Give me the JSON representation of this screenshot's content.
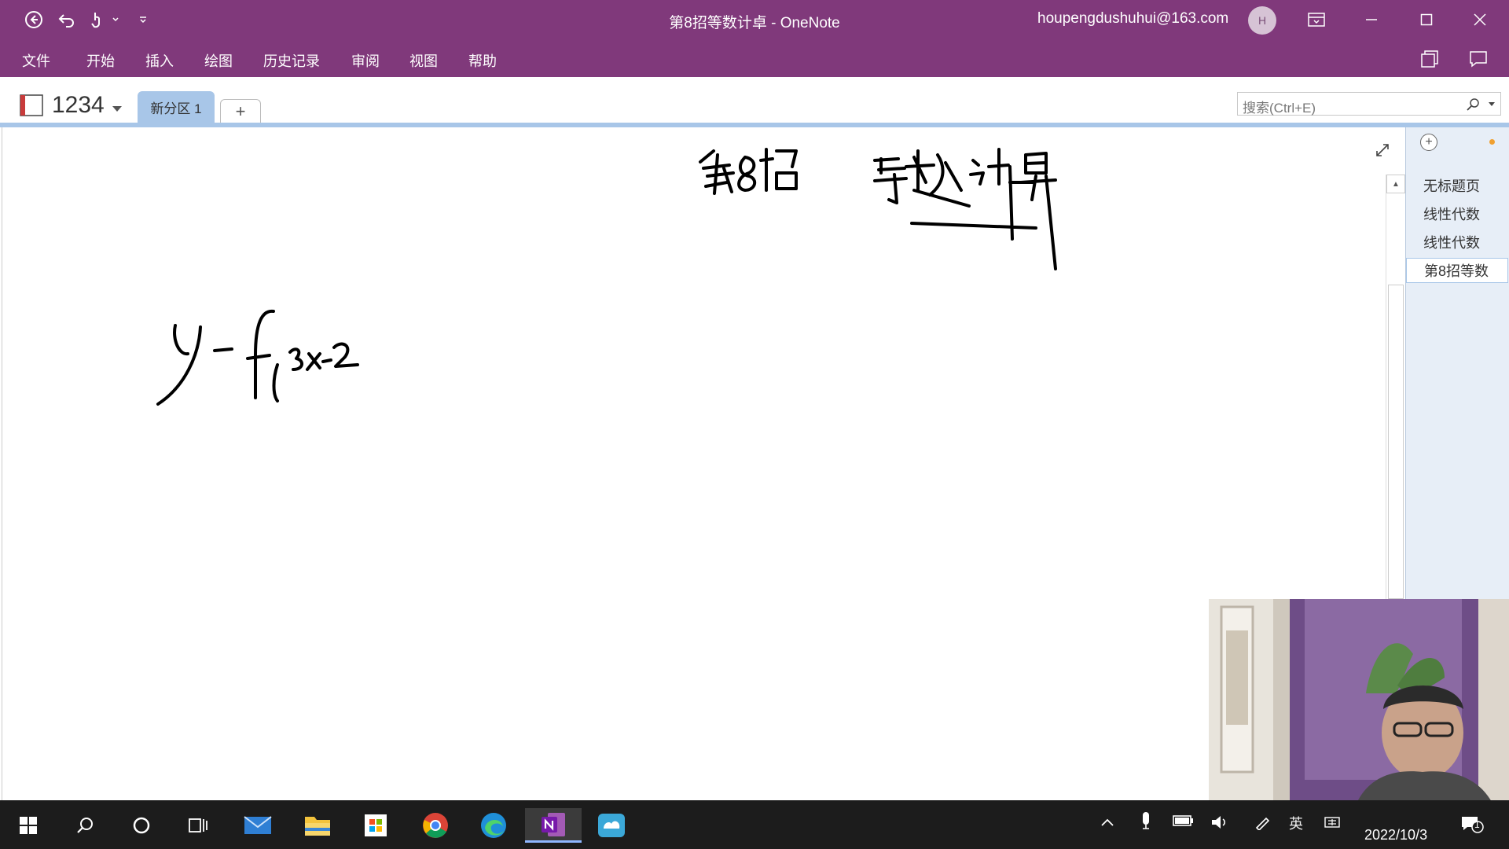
{
  "window": {
    "title": "第8招等数计卓 - OneNote",
    "account": "houpengdushuhui@163.com",
    "avatar_initial": "H"
  },
  "menu": [
    "文件",
    "开始",
    "插入",
    "绘图",
    "历史记录",
    "审阅",
    "视图",
    "帮助"
  ],
  "notebook": {
    "name": "1234",
    "section_tab": "新分区 1",
    "add_tab": "+"
  },
  "search": {
    "placeholder": "搜索(Ctrl+E)"
  },
  "pages": [
    "无标题页",
    "线性代数",
    "线性代数",
    "第8招等数"
  ],
  "pages_selected_index": 3,
  "taskbar": {
    "date": "2022/10/3",
    "ime_lang": "英",
    "notification_count": "1"
  },
  "colors": {
    "onenote_purple": "#80397b",
    "section_blue": "#a8c6e8",
    "taskbar_bg": "#1c1c1c"
  }
}
